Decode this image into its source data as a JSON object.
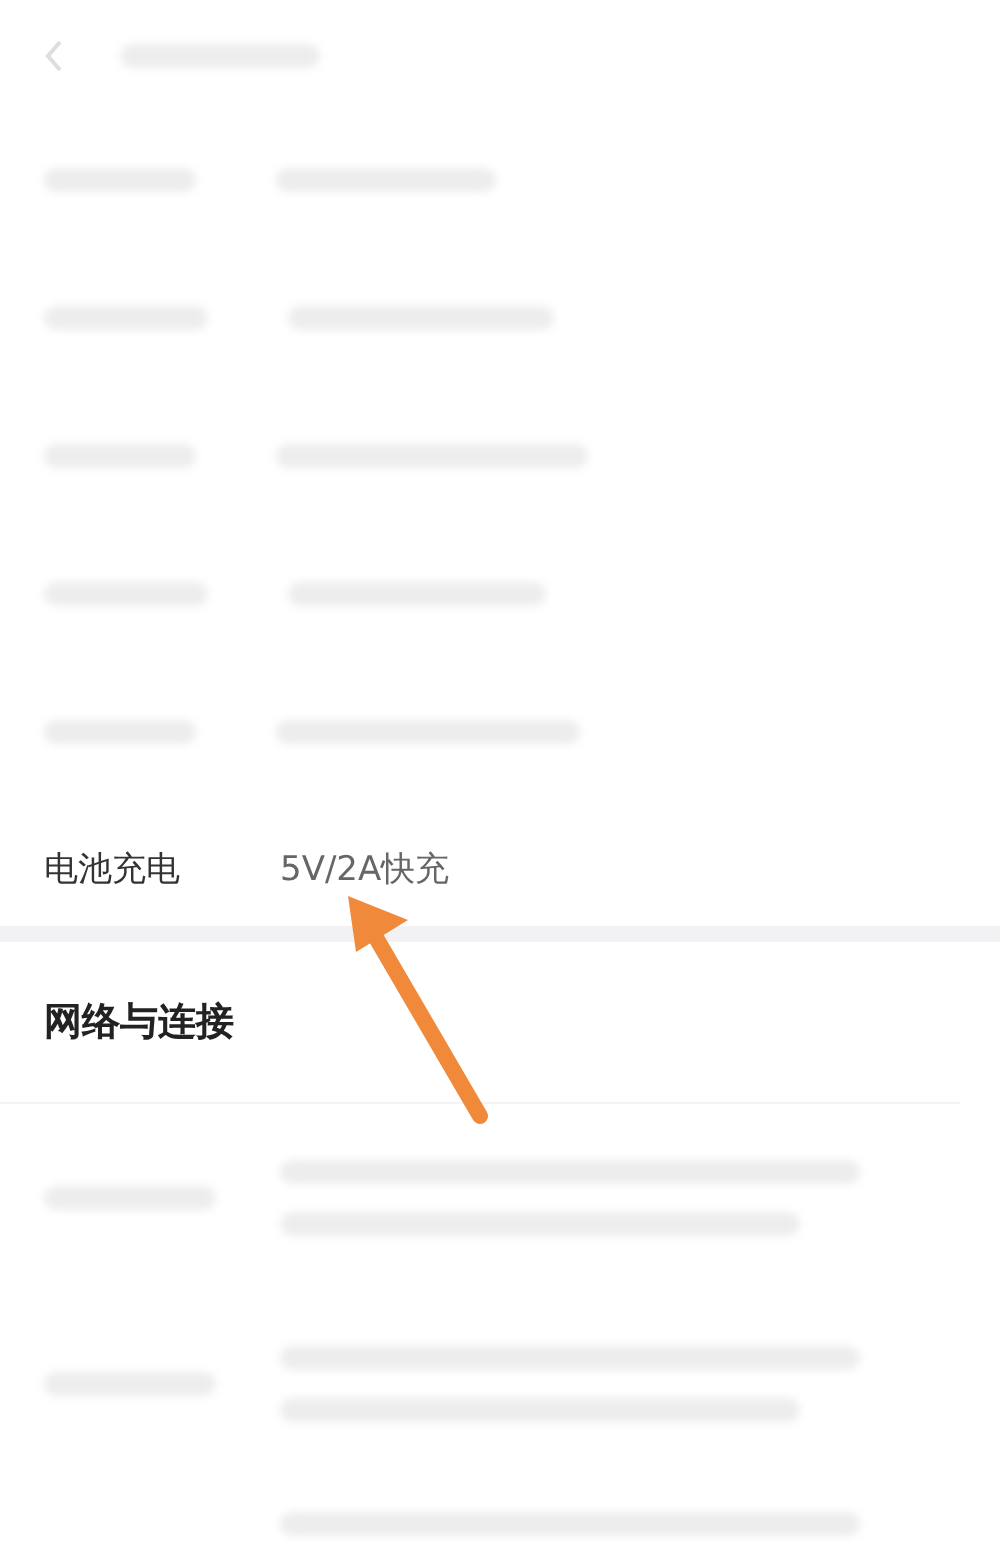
{
  "header": {
    "back_button": true
  },
  "spec_rows": [
    {
      "kind": "blurred"
    },
    {
      "kind": "blurred"
    },
    {
      "kind": "blurred"
    },
    {
      "kind": "blurred"
    },
    {
      "kind": "blurred"
    },
    {
      "kind": "text",
      "label": "电池充电",
      "value": "5V/2A快充"
    }
  ],
  "section": {
    "title": "网络与连接"
  },
  "network_rows": [
    {
      "kind": "blurred"
    },
    {
      "kind": "blurred"
    },
    {
      "kind": "blurred_partial"
    }
  ]
}
